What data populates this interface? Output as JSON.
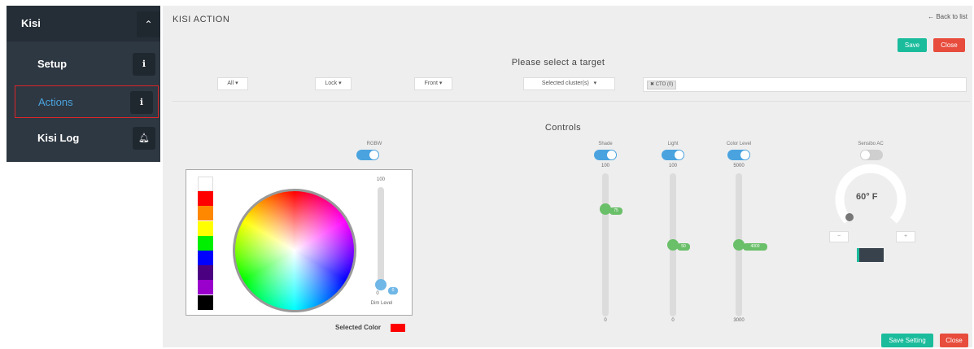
{
  "sidebar": {
    "header_label": "Kisi",
    "collapse_icon": "chevron-up-icon",
    "items": [
      {
        "label": "Setup",
        "icon": "info-icon",
        "active": false
      },
      {
        "label": "Actions",
        "icon": "info-icon",
        "active": true
      },
      {
        "label": "Kisi Log",
        "icon": "bell-icon",
        "active": false
      }
    ]
  },
  "header": {
    "title": "KISI ACTION",
    "back_link": "← Back to list",
    "save_label": "Save",
    "close_label": "Close"
  },
  "target": {
    "heading": "Please select a target",
    "dropdowns": [
      "All",
      "Lock",
      "Front",
      "Selected cluster(s)"
    ],
    "tag": "✖ CTO (0)"
  },
  "controls": {
    "heading": "Controls",
    "rgbw": {
      "label": "RGBW",
      "enabled": true,
      "swatch_colors": [
        "#ffffff",
        "#ff0000",
        "#ff8800",
        "#ffff00",
        "#00ee00",
        "#0000ff",
        "#4b0082",
        "#9900cc",
        "#000000"
      ],
      "dim_max": "100",
      "dim_min": "0",
      "dim_value": "0",
      "dim_label": "Dim Level",
      "selected_color_label": "Selected Color",
      "selected_color": "#ff0000"
    },
    "sliders": [
      {
        "label": "Shade",
        "enabled": true,
        "max": "100",
        "min": "0",
        "value": "75",
        "value_fraction": 0.75
      },
      {
        "label": "Light",
        "enabled": true,
        "max": "100",
        "min": "0",
        "value": "50",
        "value_fraction": 0.5
      },
      {
        "label": "Color Level",
        "enabled": true,
        "max": "5000",
        "min": "3000",
        "value": "4000",
        "value_fraction": 0.5
      }
    ],
    "ac": {
      "label": "Sensibo AC",
      "enabled": false,
      "temperature": "60° F",
      "minus_label": "−",
      "plus_label": "+"
    }
  },
  "footer": {
    "save_setting_label": "Save Setting",
    "close_label": "Close"
  },
  "colors": {
    "teal": "#1abc9c",
    "red": "#e74c3c",
    "accent_blue": "#4aa3df",
    "slider_green": "#6abf69"
  }
}
